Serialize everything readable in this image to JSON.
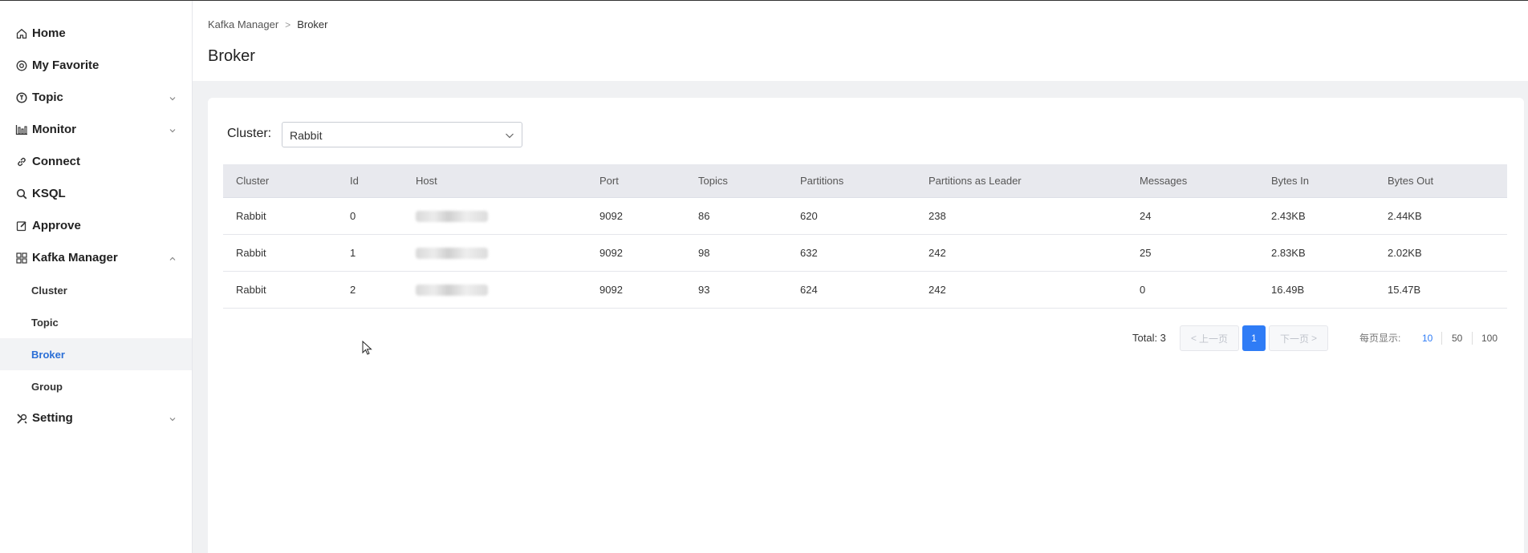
{
  "sidebar": {
    "items": [
      {
        "label": "Home",
        "icon": "home-icon"
      },
      {
        "label": "My Favorite",
        "icon": "star-circle-icon"
      },
      {
        "label": "Topic",
        "icon": "topic-icon",
        "expandable": true
      },
      {
        "label": "Monitor",
        "icon": "chart-icon",
        "expandable": true
      },
      {
        "label": "Connect",
        "icon": "link-icon"
      },
      {
        "label": "KSQL",
        "icon": "search-icon"
      },
      {
        "label": "Approve",
        "icon": "edit-icon"
      },
      {
        "label": "Kafka Manager",
        "icon": "grid-icon",
        "expanded": true
      },
      {
        "label": "Setting",
        "icon": "tools-icon",
        "expandable": true
      }
    ],
    "kafka_manager_children": [
      "Cluster",
      "Topic",
      "Broker",
      "Group"
    ],
    "active_child": "Broker"
  },
  "header": {
    "breadcrumb": [
      "Kafka Manager",
      "Broker"
    ],
    "title": "Broker"
  },
  "filter": {
    "cluster_label": "Cluster:",
    "cluster_value": "Rabbit"
  },
  "table": {
    "columns": [
      "Cluster",
      "Id",
      "Host",
      "Port",
      "Topics",
      "Partitions",
      "Partitions as Leader",
      "Messages",
      "Bytes In",
      "Bytes Out"
    ],
    "rows": [
      [
        "Rabbit",
        "0",
        "",
        "9092",
        "86",
        "620",
        "238",
        "24",
        "2.43KB",
        "2.44KB"
      ],
      [
        "Rabbit",
        "1",
        "",
        "9092",
        "98",
        "632",
        "242",
        "25",
        "2.83KB",
        "2.02KB"
      ],
      [
        "Rabbit",
        "2",
        "",
        "9092",
        "93",
        "624",
        "242",
        "0",
        "16.49B",
        "15.47B"
      ]
    ]
  },
  "pagination": {
    "total": "Total: 3",
    "prev": "上一页",
    "next": "下一页",
    "current_page": "1",
    "per_page_label": "每页显示:",
    "per_page_options": [
      "10",
      "50",
      "100"
    ],
    "per_page_selected": "10"
  },
  "colors": {
    "accent": "#2f7cf6",
    "active_text": "#2b6fd6",
    "table_header_bg": "#e8e9ee"
  }
}
